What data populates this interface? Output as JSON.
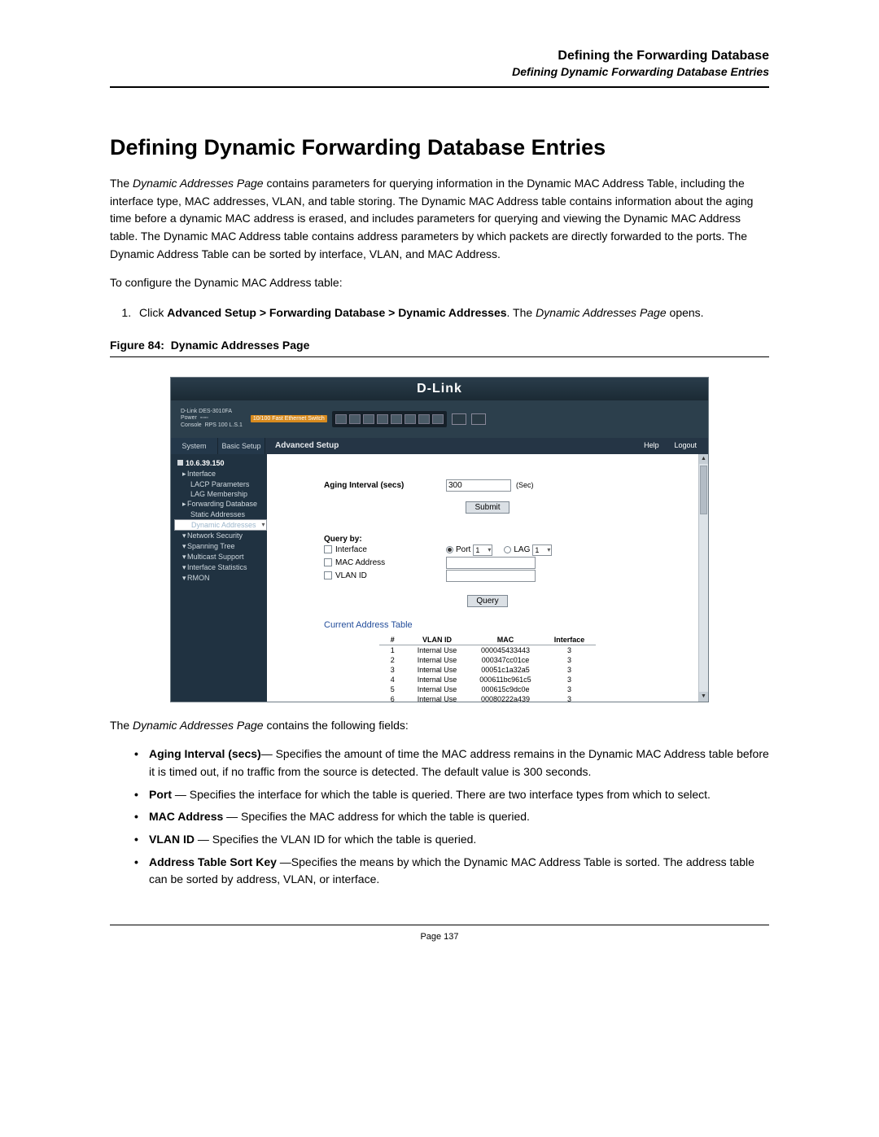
{
  "header": {
    "chapter": "Defining the Forwarding Database",
    "section": "Defining Dynamic Forwarding Database Entries"
  },
  "title": "Defining Dynamic Forwarding Database Entries",
  "intro_html": "The <span class=\"it\">Dynamic Addresses Page</span> contains parameters for querying information in the Dynamic MAC Address Table, including the interface type, MAC addresses, VLAN, and table storing. The Dynamic MAC Address table contains information about the aging time before a dynamic MAC address is erased, and includes parameters for querying and viewing the Dynamic MAC Address table. The Dynamic MAC Address table contains address parameters by which packets are directly forwarded to the ports. The Dynamic Address Table can be sorted by interface, VLAN, and MAC Address.",
  "lead_in": "To configure the Dynamic MAC Address table:",
  "step_html": "Click <span class=\"b\">Advanced Setup &gt; Forwarding Database &gt; Dynamic Addresses</span>. The <span class=\"it\">Dynamic Addresses Page</span> opens.",
  "figure_caption_label": "Figure 84:",
  "figure_caption_title": "Dynamic Addresses Page",
  "fields_intro_html": "The <span class=\"it\">Dynamic Addresses Page</span> contains the following fields:",
  "bullets": [
    "<span class=\"b\">Aging Interval (secs)</span>— Specifies the amount of time the MAC address remains in the Dynamic MAC Address table before it is timed out, if no traffic from the source is detected. The default value is 300 seconds.",
    "<span class=\"b\">Port</span> — Specifies the interface for which the table is queried. There are two interface types from which to select.",
    "<span class=\"b\">MAC Address</span> — Specifies the MAC address for which the table is queried.",
    "<span class=\"b\">VLAN ID</span> — Specifies the VLAN ID for which the table is queried.",
    "<span class=\"b\">Address Table Sort Key</span> —Specifies the means by which the Dynamic MAC Address Table is sorted. The address table can be sorted by address, VLAN, or interface."
  ],
  "page_number": "Page 137",
  "ui": {
    "brand": "D-Link",
    "device_model": "D-Link DES-3010FA",
    "device_switch_badge": "10/100 Fast Ethernet Switch",
    "port_numbers": [
      "1",
      "2",
      "3",
      "4",
      "5",
      "6",
      "7",
      "8"
    ],
    "tabs": {
      "system": "System",
      "basic": "Basic Setup"
    },
    "advanced_setup": "Advanced Setup",
    "help": "Help",
    "logout": "Logout",
    "ip": "10.6.39.150",
    "tree": {
      "interface": "Interface",
      "lacp": "LACP Parameters",
      "lag": "LAG Membership",
      "fwd": "Forwarding Database",
      "static": "Static Addresses",
      "dynamic": "Dynamic Addresses",
      "netsec": "Network Security",
      "span": "Spanning Tree",
      "mcast": "Multicast Support",
      "ifstats": "Interface Statistics",
      "rmon": "RMON"
    },
    "form": {
      "aging_label": "Aging Interval (secs)",
      "aging_value": "300",
      "aging_unit": "(Sec)",
      "submit": "Submit",
      "query_by": "Query by:",
      "interface": "Interface",
      "port": "Port",
      "port_value": "1",
      "lag": "LAG",
      "lag_value": "1",
      "mac": "MAC Address",
      "vlan": "VLAN ID",
      "query": "Query"
    },
    "table": {
      "title": "Current Address Table",
      "headers": {
        "num": "#",
        "vlan": "VLAN ID",
        "mac": "MAC",
        "if": "Interface"
      },
      "rows": [
        {
          "n": "1",
          "vlan": "Internal Use",
          "mac": "000045433443",
          "if": "3"
        },
        {
          "n": "2",
          "vlan": "Internal Use",
          "mac": "000347cc01ce",
          "if": "3"
        },
        {
          "n": "3",
          "vlan": "Internal Use",
          "mac": "00051c1a32a5",
          "if": "3"
        },
        {
          "n": "4",
          "vlan": "Internal Use",
          "mac": "000611bc961c5",
          "if": "3"
        },
        {
          "n": "5",
          "vlan": "Internal Use",
          "mac": "000615c9dc0e",
          "if": "3"
        },
        {
          "n": "6",
          "vlan": "Internal Use",
          "mac": "00080222a439",
          "if": "3"
        }
      ]
    }
  }
}
